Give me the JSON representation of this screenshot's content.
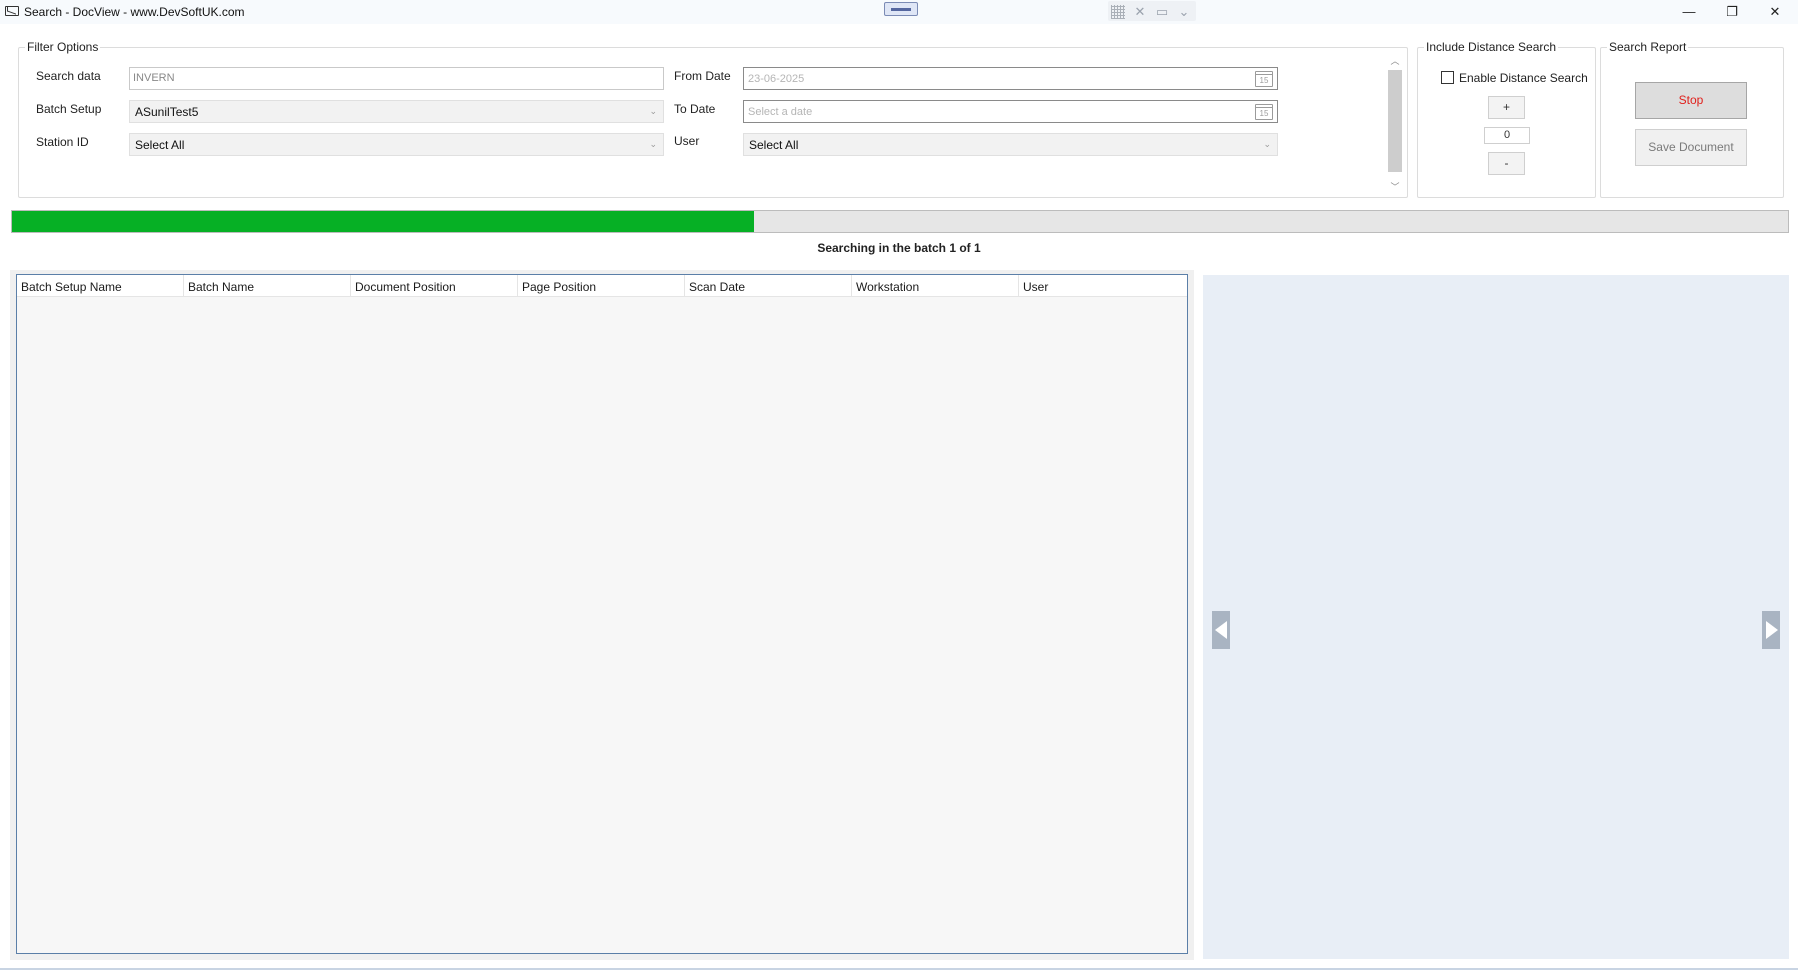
{
  "window": {
    "title": "Search - DocView - www.DevSoftUK.com",
    "minimize": "—",
    "maximize": "❐",
    "close": "✕"
  },
  "filter_options": {
    "legend": "Filter Options",
    "search_data_label": "Search data",
    "search_data_value": "INVERN",
    "batch_setup_label": "Batch Setup",
    "batch_setup_value": "ASunilTest5",
    "station_id_label": "Station ID",
    "station_id_value": "Select All",
    "from_date_label": "From Date",
    "from_date_value": "23-06-2025",
    "to_date_label": "To Date",
    "to_date_placeholder": "Select a date",
    "user_label": "User",
    "user_value": "Select All",
    "calendar_day": "15"
  },
  "distance_search": {
    "legend": "Include Distance Search",
    "enable_label": "Enable Distance Search",
    "enabled": false,
    "plus_label": "+",
    "value": "0",
    "minus_label": "-"
  },
  "search_report": {
    "legend": "Search Report",
    "stop_label": "Stop",
    "save_label": "Save Document"
  },
  "progress": {
    "fraction": 0.418,
    "status_text": "Searching in the batch 1 of 1",
    "fill_color": "#06b025"
  },
  "results_table": {
    "columns": [
      "Batch Setup Name",
      "Batch Name",
      "Document Position",
      "Page Position",
      "Scan Date",
      "Workstation",
      "User"
    ],
    "rows": []
  },
  "icons": {
    "app": "app-icon",
    "calendar": "calendar-icon",
    "prev": "previous-arrow-icon",
    "next": "next-arrow-icon"
  }
}
